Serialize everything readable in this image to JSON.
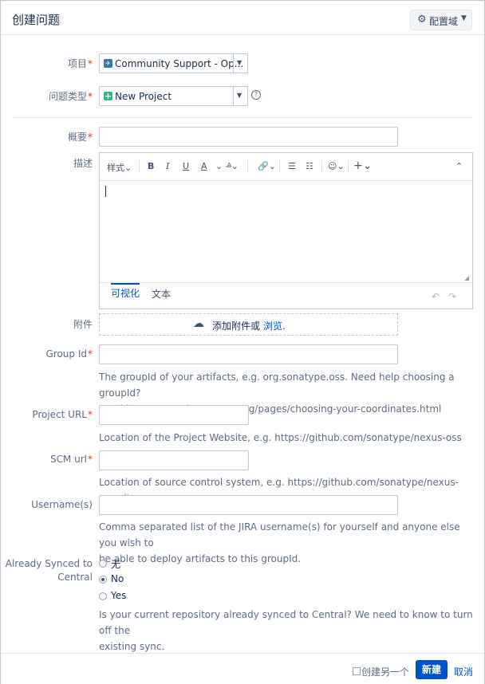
{
  "header": {
    "title": "创建问题",
    "config_label": "配置域"
  },
  "form": {
    "project": {
      "label": "项目",
      "value": "Community Support - Op..."
    },
    "issue_type": {
      "label": "问题类型",
      "value": "New Project"
    },
    "summary": {
      "label": "概要"
    },
    "description": {
      "label": "描述",
      "toolbar": {
        "style": "样式",
        "bold": "B",
        "italic": "I",
        "underline": "U",
        "color": "A"
      },
      "tabs": {
        "visual": "可视化",
        "text": "文本"
      }
    },
    "attachment": {
      "label": "附件",
      "text": "添加附件或",
      "browse": "浏览."
    },
    "group_id": {
      "label": "Group Id",
      "help1": "The groupId of your artifacts, e.g. org.sonatype.oss. Need help choosing a groupId?",
      "help2": "Read http://central.sonatype.org/pages/choosing-your-coordinates.html"
    },
    "project_url": {
      "label": "Project URL",
      "help": "Location of the Project Website, e.g. https://github.com/sonatype/nexus-oss"
    },
    "scm_url": {
      "label": "SCM url",
      "help": "Location of source control system, e.g. https://github.com/sonatype/nexus-oss.git"
    },
    "usernames": {
      "label": "Username(s)",
      "help1": "Comma separated list of the JIRA username(s) for yourself and anyone else you wish to",
      "help2": "be able to deploy artifacts to this groupId."
    },
    "synced": {
      "label1": "Already Synced to",
      "label2": "Central",
      "options": [
        "无",
        "No",
        "Yes"
      ],
      "selected": "No",
      "help1": "Is your current repository already synced to Central? We need to know to turn off the",
      "help2": "existing sync."
    }
  },
  "footer": {
    "create_another": "创建另一个",
    "create": "新建",
    "cancel": "取消"
  },
  "required_mark": "*",
  "colors": {
    "accent": "#0052cc",
    "required": "#de350b"
  }
}
